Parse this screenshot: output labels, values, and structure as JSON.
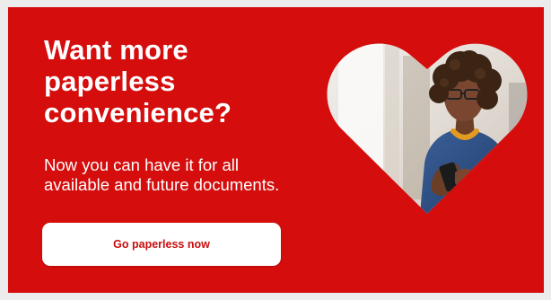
{
  "banner": {
    "headline_lines": [
      "Want more",
      "paperless",
      "convenience?"
    ],
    "body_lines": [
      "Now you can have it for all",
      "available and future documents."
    ],
    "cta_label": "Go paperless now",
    "photo_icon": "woman-with-phone-photo",
    "colors": {
      "background": "#d50d0d",
      "cta_background": "#ffffff",
      "cta_text": "#c80d0d",
      "text": "#ffffff"
    }
  }
}
